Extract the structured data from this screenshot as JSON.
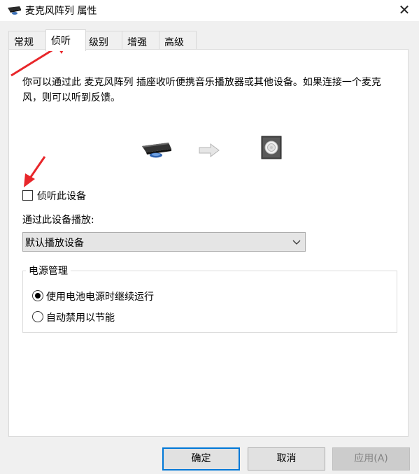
{
  "window": {
    "title": "麦克风阵列 属性",
    "close_glyph": "✕"
  },
  "tabs": [
    {
      "label": "常规",
      "active": false
    },
    {
      "label": "侦听",
      "active": true
    },
    {
      "label": "级别",
      "active": false
    },
    {
      "label": "增强",
      "active": false
    },
    {
      "label": "高级",
      "active": false
    }
  ],
  "listen": {
    "description": "你可以通过此 麦克风阵列 插座收听便携音乐播放器或其他设备。如果连接一个麦克风，则可以听到反馈。",
    "checkbox_label": "侦听此设备",
    "checkbox_checked": false,
    "playback_label": "通过此设备播放:",
    "playback_selected": "默认播放设备",
    "power_group_title": "电源管理",
    "power_options": [
      {
        "label": "使用电池电源时继续运行",
        "checked": true
      },
      {
        "label": "自动禁用以节能",
        "checked": false
      }
    ]
  },
  "buttons": {
    "ok": "确定",
    "cancel": "取消",
    "apply": "应用(A)"
  },
  "icons": {
    "title": "microphone-array-icon",
    "source": "microphone-icon",
    "flow": "right-arrow-icon",
    "target": "speaker-icon",
    "dropdown": "chevron-down-icon"
  },
  "colors": {
    "annotation_arrow": "#e8262a",
    "focus_border": "#0078d7"
  }
}
